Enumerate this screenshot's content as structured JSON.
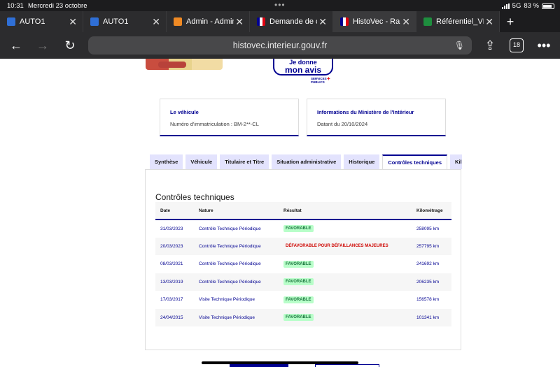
{
  "status": {
    "time": "10:31",
    "date": "Mercredi 23 octobre",
    "network": "5G",
    "battery": "83 %"
  },
  "browser_tabs": [
    {
      "title": "AUTO1",
      "favicon_color": "#2f6fd6",
      "active": false
    },
    {
      "title": "AUTO1",
      "favicon_color": "#2f6fd6",
      "active": false
    },
    {
      "title": "Admin - Admin",
      "favicon_color": "#f08a24",
      "active": false
    },
    {
      "title": "Demande de c",
      "favicon_color": "#e1000f",
      "active": false
    },
    {
      "title": "HistoVec - Rap",
      "favicon_color": "#e1000f",
      "active": true
    },
    {
      "title": "Référentiel_VIN",
      "favicon_color": "#1e8e3e",
      "active": false
    }
  ],
  "toolbar": {
    "url": "histovec.interieur.gouv.fr",
    "tab_count": "18"
  },
  "banner": {
    "avis_line1": "Je donne",
    "avis_line2": "mon avis",
    "services_publics": "SERVICES PUBLICS"
  },
  "vehicle_card": {
    "heading": "Le véhicule",
    "value": "Numéro d'immatriculation : BM-2**-CL"
  },
  "ministry_card": {
    "heading": "Informations du Ministère de l'Intérieur",
    "value": "Datant du 20/10/2024"
  },
  "page_tabs": [
    {
      "label": "Synthèse",
      "active": false
    },
    {
      "label": "Véhicule",
      "active": false
    },
    {
      "label": "Titulaire et Titre",
      "active": false
    },
    {
      "label": "Situation administrative",
      "active": false
    },
    {
      "label": "Historique",
      "active": false
    },
    {
      "label": "Contrôles techniques",
      "active": true
    },
    {
      "label": "Kil",
      "active": false
    }
  ],
  "section_title": "Contrôles techniques",
  "table": {
    "headers": [
      "Date",
      "Nature",
      "Résultat",
      "Kilométrage"
    ],
    "rows": [
      {
        "date": "31/03/2023",
        "nature": "Contrôle Technique Périodique",
        "result": "FAVORABLE",
        "status": "ok",
        "km": "258095 km"
      },
      {
        "date": "20/03/2023",
        "nature": "Contrôle Technique Périodique",
        "result": "DÉFAVORABLE POUR DÉFAILLANCES MAJEURES",
        "status": "ko",
        "km": "257795 km"
      },
      {
        "date": "08/03/2021",
        "nature": "Contrôle Technique Périodique",
        "result": "FAVORABLE",
        "status": "ok",
        "km": "241692 km"
      },
      {
        "date": "13/03/2019",
        "nature": "Contrôle Technique Périodique",
        "result": "FAVORABLE",
        "status": "ok",
        "km": "206235 km"
      },
      {
        "date": "17/03/2017",
        "nature": "Visite Technique Périodique",
        "result": "FAVORABLE",
        "status": "ok",
        "km": "156578 km"
      },
      {
        "date": "24/04/2015",
        "nature": "Visite Technique Périodique",
        "result": "FAVORABLE",
        "status": "ok",
        "km": "101341 km"
      }
    ]
  },
  "colors": {
    "brand_blue": "#000091",
    "favorable_bg": "#b8fec9",
    "favorable_text": "#18753c",
    "defavorable_text": "#ce0500"
  }
}
